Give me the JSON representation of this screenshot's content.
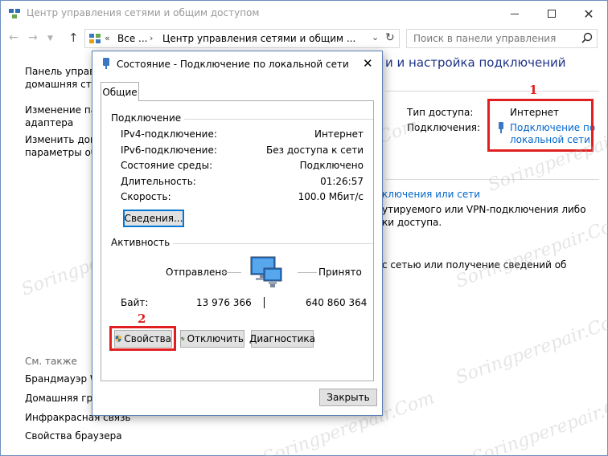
{
  "window": {
    "title": "Центр управления сетями и общим доступом",
    "breadcrumb_root": "Все ...",
    "breadcrumb_current": "Центр управления сетями и общим ...",
    "search_placeholder": "Поиск в панели управления"
  },
  "sidebar": {
    "items": [
      {
        "label": "Панель управле"
      },
      {
        "label": "домашняя стра"
      },
      {
        "label": "Изменение пар"
      },
      {
        "label": "адаптера"
      },
      {
        "label": "Изменить допо"
      },
      {
        "label": "параметры общ"
      }
    ],
    "see_also_title": "См. также",
    "see_also": [
      {
        "label": "Брандмауэр Wi"
      },
      {
        "label": "Домашняя груп"
      },
      {
        "label": "Инфракрасная связь"
      },
      {
        "label": "Свойства браузера"
      }
    ]
  },
  "main": {
    "heading": "и и настройка подключений",
    "access_type_label": "Тип доступа:",
    "access_type_value": "Интернет",
    "connections_label": "Подключения:",
    "connection_link_line1": "Подключение по",
    "connection_link_line2": "локальной сети",
    "setup_link": "ключения или сети",
    "text_line1": "утируемого или VPN-подключения либо",
    "text_line2": "ки доступа.",
    "text_line3": "с сетью или получение сведений об"
  },
  "annotations": {
    "marker1": "1",
    "marker2": "2",
    "color": "#e02020"
  },
  "dialog": {
    "title": "Состояние - Подключение по локальной сети",
    "tab": "Общие",
    "connection_group": "Подключение",
    "rows": [
      {
        "label": "IPv4-подключение:",
        "value": "Интернет"
      },
      {
        "label": "IPv6-подключение:",
        "value": "Без доступа к сети"
      },
      {
        "label": "Состояние среды:",
        "value": "Подключено"
      },
      {
        "label": "Длительность:",
        "value": "01:26:57"
      },
      {
        "label": "Скорость:",
        "value": "100.0 Мбит/с"
      }
    ],
    "details_button": "Сведения...",
    "activity_group": "Активность",
    "sent_label": "Отправлено",
    "received_label": "Принято",
    "bytes_label": "Байт:",
    "bytes_sent": "13 976 366",
    "bytes_received": "640 860 364",
    "properties_button": "Свойства",
    "disable_button": "Отключить",
    "diagnose_button": "Диагностика",
    "close_button": "Закрыть"
  },
  "watermark": "Soringperepair.Com"
}
